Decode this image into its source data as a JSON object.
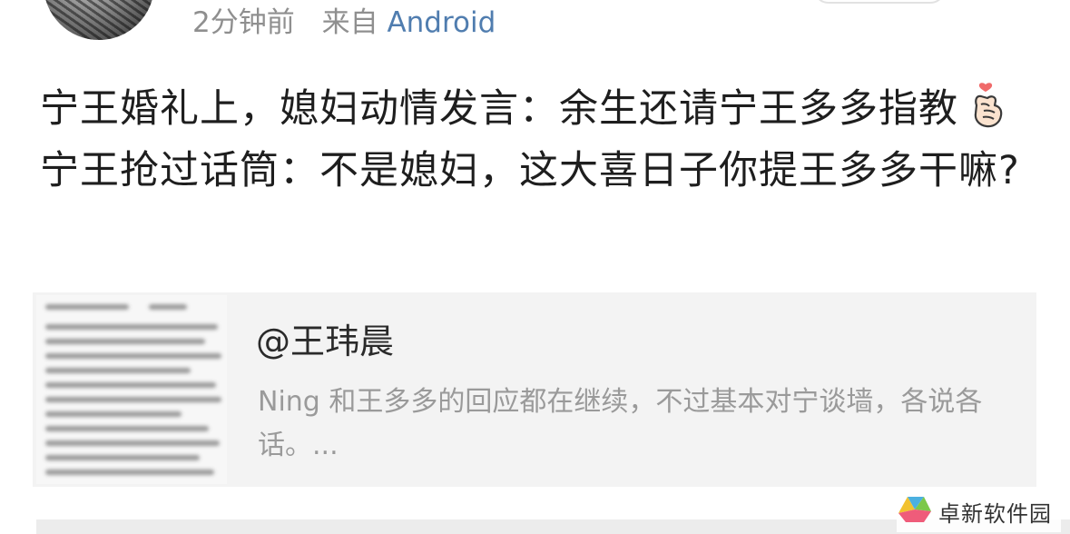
{
  "post": {
    "time": "2分钟前",
    "source_label": "来自",
    "source": "Android",
    "text_part1": "宁王婚礼上，媳妇动情发言：余生还请宁王多多指教",
    "emoji": "finger-heart",
    "text_part2": "宁王抢过话筒：不是媳妇，这大喜日子你提王多多干嘛?"
  },
  "link_card": {
    "title": "@王玮晨",
    "description": "Ning 和王多多的回应都在继续，不过基本对宁谈墙，各说各话。..."
  },
  "watermark": {
    "text": "卓新软件园"
  },
  "colors": {
    "link_blue": "#507daf",
    "meta_gray": "#8f8f8f",
    "card_bg": "#f3f3f3"
  }
}
